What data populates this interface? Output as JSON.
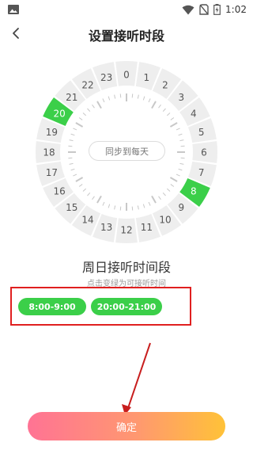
{
  "status_bar": {
    "time": "1:02",
    "left_icon": "gallery-icon",
    "right_icons": [
      "wifi-icon",
      "no-sim-icon",
      "battery-icon"
    ]
  },
  "nav": {
    "back_icon": "chevron-left-icon",
    "title": "设置接听时段"
  },
  "dial": {
    "hours": [
      "0",
      "1",
      "2",
      "3",
      "4",
      "5",
      "6",
      "7",
      "8",
      "9",
      "10",
      "11",
      "12",
      "13",
      "14",
      "15",
      "16",
      "17",
      "18",
      "19",
      "20",
      "21",
      "22",
      "23"
    ],
    "selected_hours": [
      8,
      20
    ],
    "sync_label": "同步到每天",
    "colors": {
      "segment": "#eeeeee",
      "selected": "#3bcf49",
      "tick": "#c8c8c8",
      "text": "#555555"
    }
  },
  "schedule": {
    "day_title": "周日接听时间段",
    "hint": "点击变绿为可接听时间",
    "slots": [
      "8:00-9:00",
      "20:00-21:00"
    ],
    "highlight_color": "#e02020"
  },
  "confirm_label": "确定"
}
